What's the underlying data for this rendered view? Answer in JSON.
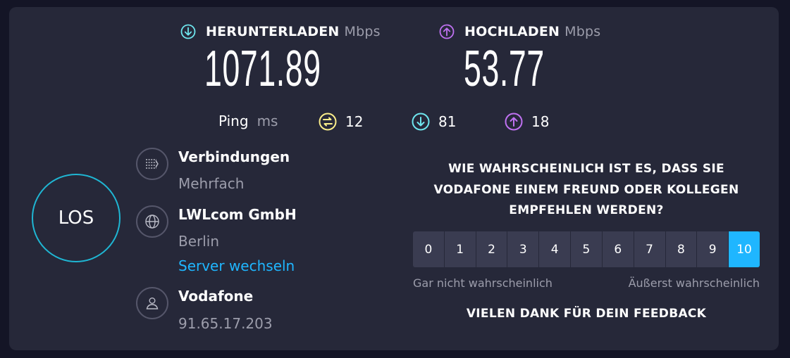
{
  "download": {
    "label": "HERUNTERLADEN",
    "unit": "Mbps",
    "value": "1071.89",
    "icon": "download-arrow-icon",
    "color": "#6ee6ee"
  },
  "upload": {
    "label": "HOCHLADEN",
    "unit": "Mbps",
    "value": "53.77",
    "icon": "upload-arrow-icon",
    "color": "#bf71f1"
  },
  "ping": {
    "label": "Ping",
    "unit": "ms",
    "idle": "12",
    "download": "81",
    "upload": "18",
    "colors": {
      "idle": "#fbee8a",
      "download": "#6ee6ee",
      "upload": "#bf71f1"
    }
  },
  "go_button": {
    "label": "LOS",
    "color": "#1fb6d3"
  },
  "connections": {
    "title": "Verbindungen",
    "value": "Mehrfach",
    "icon": "connections-icon"
  },
  "server": {
    "name": "LWLcom GmbH",
    "location": "Berlin",
    "change_link": "Server wechseln",
    "icon": "globe-icon"
  },
  "provider": {
    "name": "Vodafone",
    "ip": "91.65.17.203",
    "icon": "user-icon"
  },
  "survey": {
    "question": "WIE WAHRSCHEINLICH IST ES, DASS SIE VODAFONE EINEM FREUND ODER KOLLEGEN EMPFEHLEN WERDEN?",
    "scale": [
      "0",
      "1",
      "2",
      "3",
      "4",
      "5",
      "6",
      "7",
      "8",
      "9",
      "10"
    ],
    "selected": "10",
    "low_label": "Gar nicht wahrscheinlich",
    "high_label": "Äußerst wahrscheinlich",
    "thanks": "VIELEN DANK FÜR DEIN FEEDBACK",
    "accent": "#1fb6ff"
  }
}
